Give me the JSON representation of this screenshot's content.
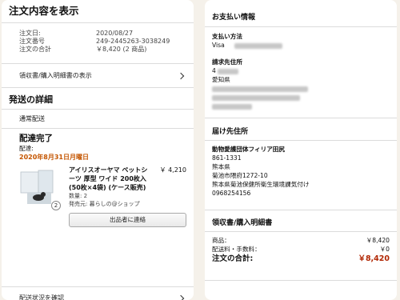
{
  "order_summary": {
    "title": "注文内容を表示",
    "date_label": "注文日:",
    "date_value": "2020/08/27",
    "number_label": "注文番号",
    "number_value": "249-2445263-3038249",
    "total_label": "注文の合計",
    "total_value": "￥8,420 (2 商品)",
    "receipt_link": "領収書/購入明細書の表示"
  },
  "shipping": {
    "title": "発送の詳細",
    "method": "通常配送",
    "status": "配達完了",
    "delivery_label": "配達:",
    "delivery_date": "2020年8月31日月曜日",
    "item_name": "アイリスオーヤマ ペットシーツ 厚型 ワイド 200枚入(50枚×4袋) (ケース販売)",
    "item_price": "￥ 4,210",
    "item_qty_badge": "2",
    "item_qty": "数量: 2",
    "seller": "発売元: 暮らしの@ショップ",
    "contact_button": "出品者に連絡",
    "track_link": "配送状況を確認"
  },
  "payment": {
    "title": "お支払い情報",
    "method_title": "支払い方法",
    "method_value": "Visa",
    "billing_title": "請求先住所",
    "billing_line1": "4",
    "billing_line2": "愛知県"
  },
  "delivery_address": {
    "title": "届け先住所",
    "name": "動物愛護団体フィリア田尻",
    "postal": "861-1331",
    "prefecture": "熊本県",
    "city": "菊池市隈府1272-10",
    "office": "熊本県菊池保健所衛生環境課気付け",
    "phone": "0968254156"
  },
  "receipt": {
    "title": "領収書/購入明細書",
    "items_label": "商品：",
    "items_value": "￥8,420",
    "shipping_label": "配送料・手数料：",
    "shipping_value": "￥0",
    "total_label": "注文の合計:",
    "total_value": "￥8,420"
  },
  "colors": {
    "delivery_date": "#c45500",
    "total_red": "#b12704",
    "background": "#f5f1ea"
  }
}
